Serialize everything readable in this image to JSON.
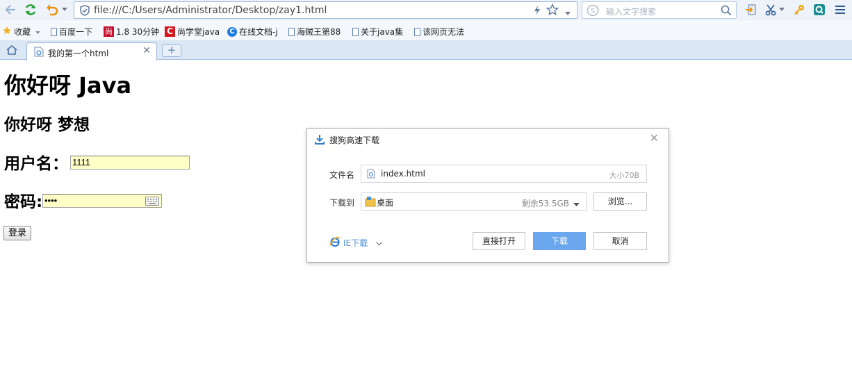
{
  "browser": {
    "address": "file:///C:/Users/Administrator/Desktop/zay1.html",
    "search_placeholder": "输入文字搜索",
    "bookmarks_label": "收藏",
    "bookmarks": [
      "百度一下",
      "1.8 30分钟",
      "尚学堂java",
      "在线文档-j",
      "海贼王第88",
      "关于java集",
      "该网页无法"
    ],
    "tab_title": "我的第一个html"
  },
  "page": {
    "heading1": "你好呀 Java",
    "heading2": "你好呀 梦想",
    "username_label": "用户名：",
    "username_value": "1111",
    "password_label": "密码:",
    "password_value": "••••",
    "login_button": "登录"
  },
  "dialog": {
    "title": "搜狗高速下载",
    "filename_label": "文件名",
    "filename": "index.html",
    "filesize": "大小70B",
    "saveto_label": "下载到",
    "folder": "桌面",
    "free_space": "剩余53.5GB",
    "browse_button": "浏览...",
    "ie_download": "IE下载",
    "open_button": "直接打开",
    "download_button": "下载",
    "cancel_button": "取消"
  },
  "colors": {
    "accent": "#6aa7ee",
    "refresh": "#2aa33b",
    "undo": "#f0900c",
    "input_bg": "#fdffc6"
  }
}
